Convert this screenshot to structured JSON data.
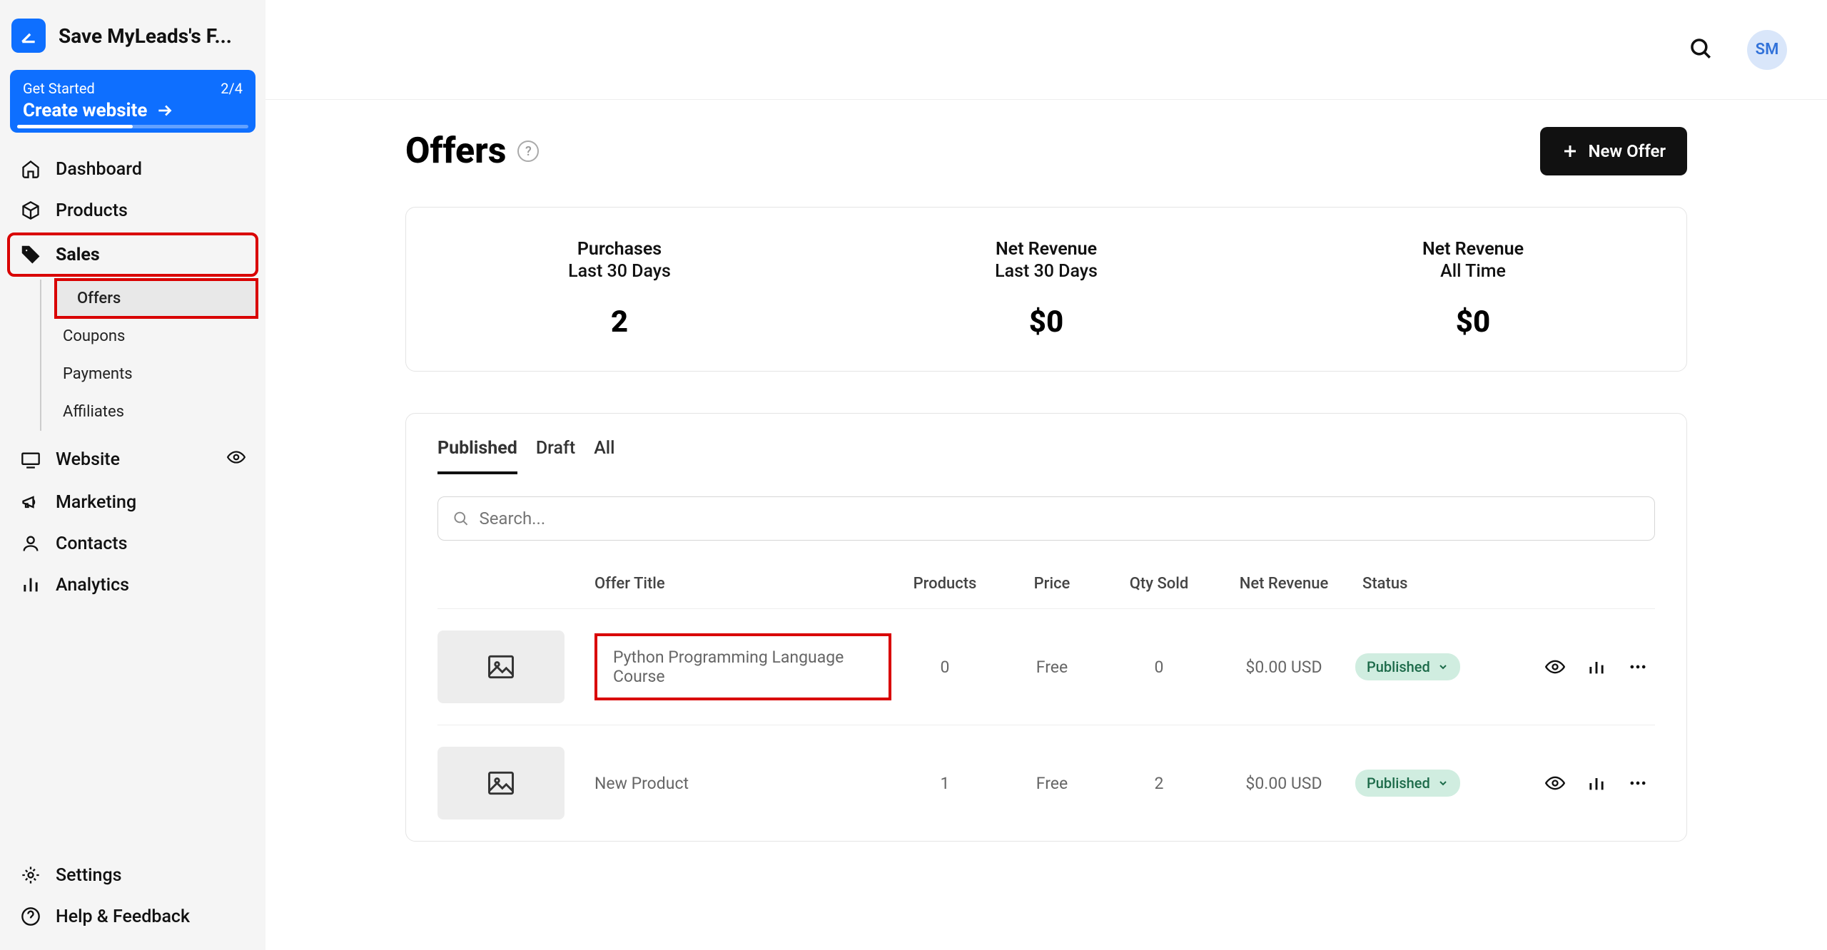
{
  "brand": {
    "name": "Save MyLeads's F..."
  },
  "getStarted": {
    "label": "Get Started",
    "progress": "2/4",
    "cta": "Create website"
  },
  "sidebar": {
    "dashboard": "Dashboard",
    "products": "Products",
    "sales": "Sales",
    "salesSub": {
      "offers": "Offers",
      "coupons": "Coupons",
      "payments": "Payments",
      "affiliates": "Affiliates"
    },
    "website": "Website",
    "marketing": "Marketing",
    "contacts": "Contacts",
    "analytics": "Analytics",
    "settings": "Settings",
    "help": "Help & Feedback"
  },
  "avatar": "SM",
  "page": {
    "title": "Offers",
    "newOffer": "New Offer"
  },
  "stats": [
    {
      "h1": "Purchases",
      "h2": "Last 30 Days",
      "val": "2"
    },
    {
      "h1": "Net Revenue",
      "h2": "Last 30 Days",
      "val": "$0"
    },
    {
      "h1": "Net Revenue",
      "h2": "All Time",
      "val": "$0"
    }
  ],
  "tabs": {
    "published": "Published",
    "draft": "Draft",
    "all": "All"
  },
  "search": {
    "placeholder": "Search..."
  },
  "columns": {
    "title": "Offer Title",
    "products": "Products",
    "price": "Price",
    "qty": "Qty Sold",
    "net": "Net Revenue",
    "status": "Status"
  },
  "rows": [
    {
      "title": "Python Programming Language Course",
      "products": "0",
      "price": "Free",
      "qty": "0",
      "net": "$0.00 USD",
      "status": "Published"
    },
    {
      "title": "New Product",
      "products": "1",
      "price": "Free",
      "qty": "2",
      "net": "$0.00 USD",
      "status": "Published"
    }
  ]
}
